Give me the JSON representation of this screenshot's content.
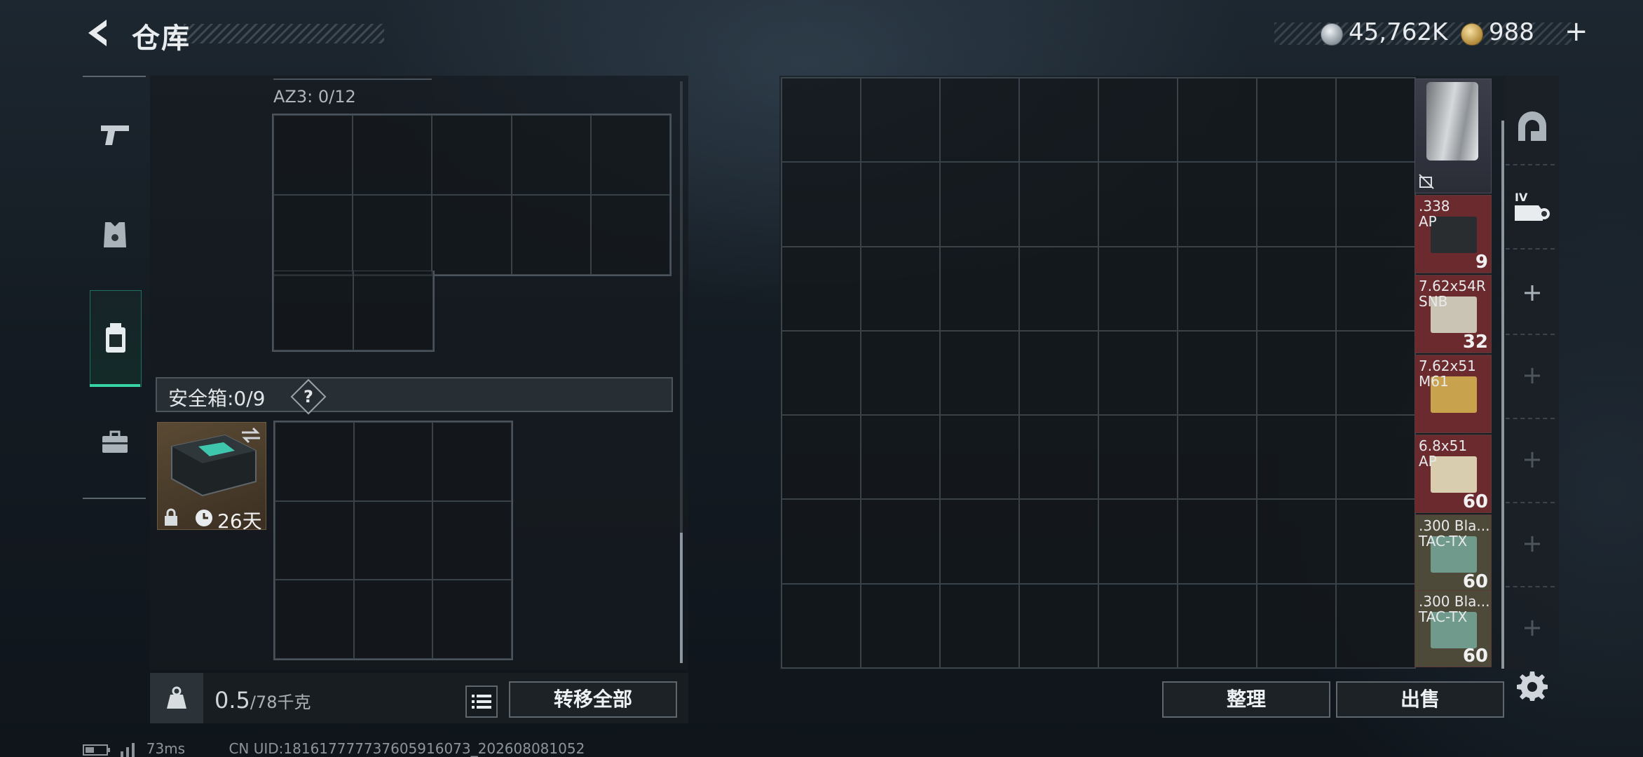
{
  "header": {
    "title": "仓库",
    "currency_silver": "45,762K",
    "currency_gold": "988",
    "add_symbol": "+"
  },
  "left_panel": {
    "container_label": "AZ3: 0/12",
    "safe_box_label": "安全箱:0/9",
    "help_symbol": "?",
    "case_days": "26天",
    "weight_current": "0.5",
    "weight_max": "/78千克",
    "transfer_all_label": "转移全部"
  },
  "stash": {
    "items": [
      {
        "name": ".338\nAP",
        "count": "9",
        "bg": "#6b2a2e",
        "box": "#2a2d2f"
      },
      {
        "name": "7.62x54R\nSNB",
        "count": "32",
        "bg": "#6b2a2e",
        "box": "#c9c4b4"
      },
      {
        "name": "7.62x51\nM61",
        "count": "",
        "bg": "#6b2a2e",
        "box": "#c9a24e"
      },
      {
        "name": "6.8x51\nAP",
        "count": "60",
        "bg": "#6b2a2e",
        "box": "#d9cdb0"
      },
      {
        "name": ".300 Bla...\nTAC-TX",
        "count": "60",
        "bg": "#4e4a3a",
        "box": "#6f9a8c"
      },
      {
        "name": ".300 Bla...\nTAC-TX",
        "count": "60",
        "bg": "#4e4a3a",
        "box": "#6f9a8c"
      }
    ],
    "sort_label": "整理",
    "sell_label": "出售"
  },
  "status_bar": {
    "ping": "73ms",
    "uid": "CN UID:181617777737605916073_202608081052"
  },
  "colors": {
    "accent": "#37d4a6",
    "ammo_red": "#6b2a2e"
  }
}
